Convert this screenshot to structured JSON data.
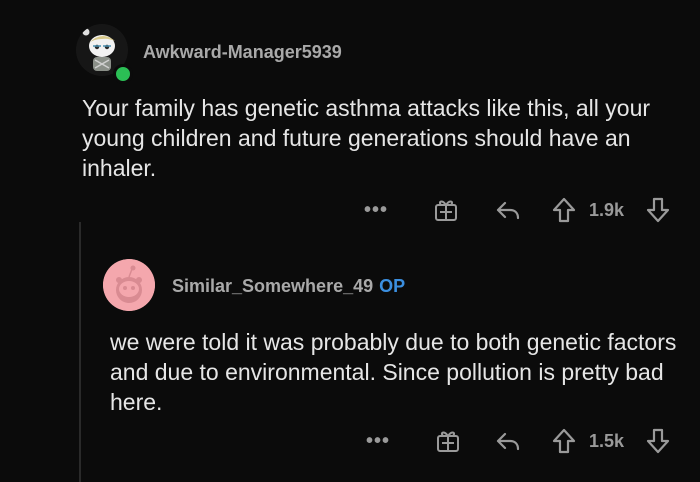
{
  "comments": [
    {
      "username": "Awkward-Manager5939",
      "text": "Your family has genetic asthma attacks like this, all your young children and future generations should have an inhaler.",
      "vote_count": "1.9k",
      "more_label": "•••"
    },
    {
      "username": "Similar_Somewhere_49",
      "op_badge": "OP",
      "text": "we were told it was probably due to both genetic factors and due to environmental. Since pollution is pretty bad here.",
      "vote_count": "1.5k",
      "more_label": "•••"
    }
  ],
  "icons": [
    "gift-award-icon",
    "reply-icon",
    "upvote-icon",
    "downvote-icon"
  ],
  "colors": {
    "background": "#0b0b0b",
    "text": "#e6e6e6",
    "muted": "#9a9a9a",
    "op_badge": "#3b8fe0",
    "online": "#2bbf55",
    "avatar2_bg": "#f4a7ad"
  }
}
